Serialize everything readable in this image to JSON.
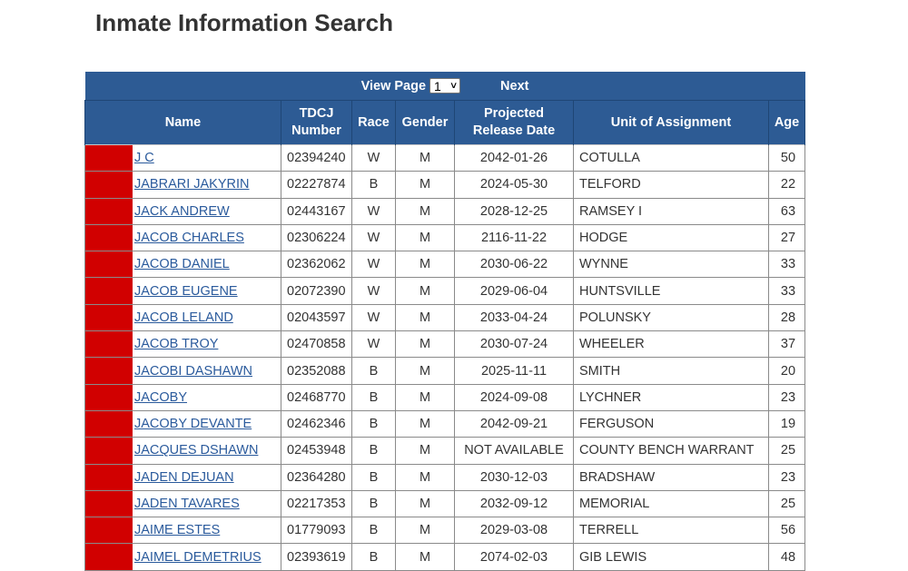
{
  "page": {
    "title": "Inmate Information Search"
  },
  "pager": {
    "view_page_label": "View Page",
    "selected_page": "1",
    "next_label": "Next"
  },
  "columns": [
    {
      "key": "name",
      "label": "Name"
    },
    {
      "key": "tdcj",
      "label": "TDCJ Number"
    },
    {
      "key": "race",
      "label": "Race"
    },
    {
      "key": "gender",
      "label": "Gender"
    },
    {
      "key": "release",
      "label": "Projected Release Date"
    },
    {
      "key": "unit",
      "label": "Unit of Assignment"
    },
    {
      "key": "age",
      "label": "Age"
    }
  ],
  "header": {
    "name": "Name",
    "tdcj_line1": "TDCJ",
    "tdcj_line2": "Number",
    "race": "Race",
    "gender": "Gender",
    "release_line1": "Projected",
    "release_line2": "Release Date",
    "unit": "Unit of Assignment",
    "age": "Age"
  },
  "colors": {
    "header_bg": "#2d5b94",
    "redaction": "#d10000",
    "link": "#2a5a9c"
  },
  "rows": [
    {
      "name": "J C",
      "tdcj": "02394240",
      "race": "W",
      "gender": "M",
      "release": "2042-01-26",
      "unit": "COTULLA",
      "age": "50"
    },
    {
      "name": "JABRARI JAKYRIN",
      "tdcj": "02227874",
      "race": "B",
      "gender": "M",
      "release": "2024-05-30",
      "unit": "TELFORD",
      "age": "22"
    },
    {
      "name": "JACK ANDREW",
      "tdcj": "02443167",
      "race": "W",
      "gender": "M",
      "release": "2028-12-25",
      "unit": "RAMSEY I",
      "age": "63"
    },
    {
      "name": "JACOB CHARLES",
      "tdcj": "02306224",
      "race": "W",
      "gender": "M",
      "release": "2116-11-22",
      "unit": "HODGE",
      "age": "27"
    },
    {
      "name": "JACOB DANIEL",
      "tdcj": "02362062",
      "race": "W",
      "gender": "M",
      "release": "2030-06-22",
      "unit": "WYNNE",
      "age": "33"
    },
    {
      "name": "JACOB EUGENE",
      "tdcj": "02072390",
      "race": "W",
      "gender": "M",
      "release": "2029-06-04",
      "unit": "HUNTSVILLE",
      "age": "33"
    },
    {
      "name": "JACOB LELAND",
      "tdcj": "02043597",
      "race": "W",
      "gender": "M",
      "release": "2033-04-24",
      "unit": "POLUNSKY",
      "age": "28"
    },
    {
      "name": "JACOB TROY",
      "tdcj": "02470858",
      "race": "W",
      "gender": "M",
      "release": "2030-07-24",
      "unit": "WHEELER",
      "age": "37"
    },
    {
      "name": "JACOBI DASHAWN",
      "tdcj": "02352088",
      "race": "B",
      "gender": "M",
      "release": "2025-11-11",
      "unit": "SMITH",
      "age": "20"
    },
    {
      "name": "JACOBY",
      "tdcj": "02468770",
      "race": "B",
      "gender": "M",
      "release": "2024-09-08",
      "unit": "LYCHNER",
      "age": "23"
    },
    {
      "name": "JACOBY DEVANTE",
      "tdcj": "02462346",
      "race": "B",
      "gender": "M",
      "release": "2042-09-21",
      "unit": "FERGUSON",
      "age": "19"
    },
    {
      "name": "JACQUES DSHAWN",
      "tdcj": "02453948",
      "race": "B",
      "gender": "M",
      "release": "NOT AVAILABLE",
      "unit": "COUNTY BENCH WARRANT",
      "age": "25"
    },
    {
      "name": "JADEN DEJUAN",
      "tdcj": "02364280",
      "race": "B",
      "gender": "M",
      "release": "2030-12-03",
      "unit": "BRADSHAW",
      "age": "23"
    },
    {
      "name": "JADEN TAVARES",
      "tdcj": "02217353",
      "race": "B",
      "gender": "M",
      "release": "2032-09-12",
      "unit": "MEMORIAL",
      "age": "25"
    },
    {
      "name": "JAIME ESTES",
      "tdcj": "01779093",
      "race": "B",
      "gender": "M",
      "release": "2029-03-08",
      "unit": "TERRELL",
      "age": "56"
    },
    {
      "name": "JAIMEL DEMETRIUS",
      "tdcj": "02393619",
      "race": "B",
      "gender": "M",
      "release": "2074-02-03",
      "unit": "GIB LEWIS",
      "age": "48"
    }
  ]
}
